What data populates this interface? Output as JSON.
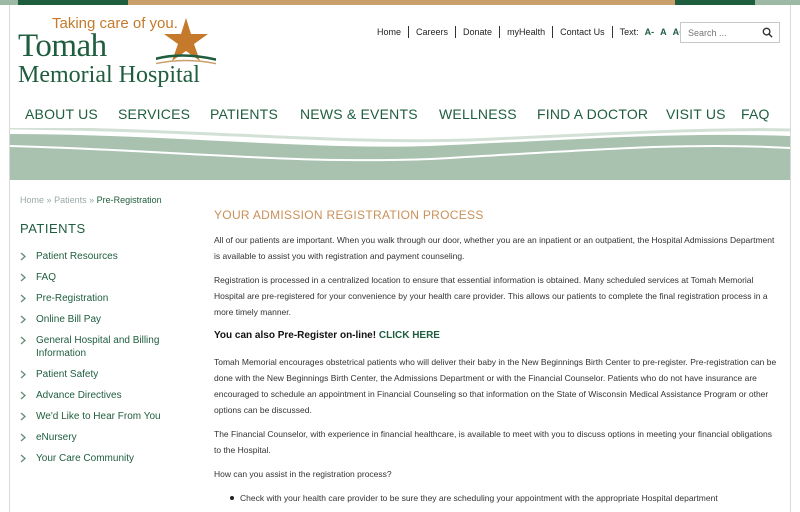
{
  "header": {
    "tagline": "Taking care of you.",
    "logo_line1": "Tomah",
    "logo_line2": "Memorial Hospital"
  },
  "utility_nav": {
    "items": [
      "Home",
      "Careers",
      "Donate",
      "myHealth",
      "Contact Us"
    ],
    "text_size_label": "Text:",
    "text_size_options": [
      "A-",
      "A",
      "A+"
    ]
  },
  "search": {
    "placeholder": "Search ...",
    "icon": "search-icon"
  },
  "main_nav": {
    "items": [
      "ABOUT US",
      "SERVICES",
      "PATIENTS",
      "NEWS & EVENTS",
      "WELLNESS",
      "FIND A DOCTOR",
      "VISIT US",
      "FAQ"
    ]
  },
  "breadcrumb": {
    "items": [
      "Home",
      "Patients"
    ],
    "separator": "»",
    "current": "Pre-Registration"
  },
  "sidebar": {
    "title": "PATIENTS",
    "items": [
      "Patient Resources",
      "FAQ",
      "Pre-Registration",
      "Online Bill Pay",
      "General Hospital and Billing Information",
      "Patient Safety",
      "Advance Directives",
      "We'd Like to Hear From You",
      "eNursery",
      "Your Care Community"
    ]
  },
  "content": {
    "heading": "YOUR ADMISSION REGISTRATION PROCESS",
    "p1": "All of our patients are important. When you walk through our door, whether you are an inpatient or an outpatient, the Hospital Admissions Department is available to assist you with registration and payment counseling.",
    "p2": "Registration is processed in a centralized location to ensure that essential information is obtained. Many scheduled services at Tomah Memorial Hospital are pre-registered for your convenience by your health care provider. This allows our patients to complete the final registration process in a more timely manner.",
    "online_prefix": "You can also Pre-Register on-line!",
    "online_link": "CLICK HERE",
    "p3": "Tomah Memorial encourages obstetrical patients who will deliver their baby in the New Beginnings Birth Center to pre-register. Pre-registration can be done with the New Beginnings Birth Center, the Admissions Department or with the Financial Counselor. Patients who do not have insurance are encouraged to schedule an appointment in Financial Counseling so that information on the State of Wisconsin Medical Assistance Program or other options can be discussed.",
    "p4": "The Financial Counselor, with experience in financial healthcare, is available to meet with you to discuss options in meeting your financial obligations to the Hospital.",
    "p5": "How can you assist in the registration process?",
    "bullets": [
      "Check with your health care provider to be sure they are scheduling your appointment with the appropriate Hospital department"
    ]
  },
  "colors": {
    "brand_green": "#1f5d3f",
    "brand_orange": "#c47a2a",
    "heading_tan": "#c9905a",
    "wave_sage": "#9db8a5"
  }
}
